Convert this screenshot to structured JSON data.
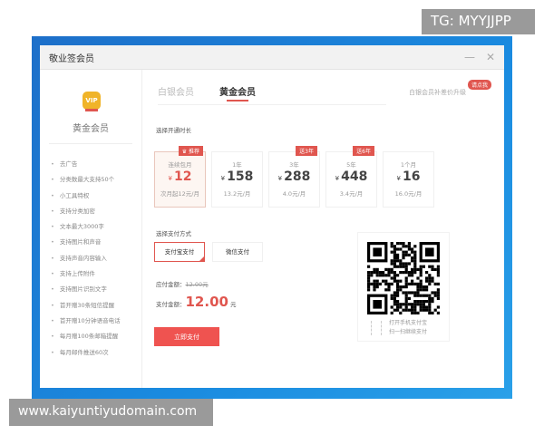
{
  "watermarks": {
    "top": "TG: MYYJJPP",
    "bottom": "www.kaiyuntiyudomain.com"
  },
  "window": {
    "title": "敬业签会员",
    "minimize": "—",
    "close": "✕"
  },
  "sidebar": {
    "badge": "VIP",
    "title": "黄金会员",
    "features": [
      "去广告",
      "分类数最大支持50个",
      "小工具特权",
      "支持分类加密",
      "文本最大3000字",
      "支持图片和声音",
      "支持声音内容输入",
      "支持上传附件",
      "支持图片识别文字",
      "首开赠30条短信提醒",
      "首开赠10分钟语音电话",
      "每月赠100条邮箱提醒",
      "每月邮件推送60次"
    ]
  },
  "tabs": [
    {
      "label": "白银会员",
      "active": false
    },
    {
      "label": "黄金会员",
      "active": true
    }
  ],
  "upgrade": {
    "label": "白银会员补差价升级",
    "badge": "请点我"
  },
  "duration_label": "选择开通时长",
  "currency": "¥",
  "plans": [
    {
      "name": "连续包月",
      "price": "12",
      "monthly": "次月起12元/月",
      "tag": "♛ 推荐",
      "selected": true
    },
    {
      "name": "1年",
      "price": "158",
      "monthly": "13.2元/月",
      "tag": "",
      "selected": false
    },
    {
      "name": "3年",
      "price": "288",
      "monthly": "4.0元/月",
      "tag": "送3年",
      "selected": false
    },
    {
      "name": "5年",
      "price": "448",
      "monthly": "3.4元/月",
      "tag": "送6年",
      "selected": false
    },
    {
      "name": "1个月",
      "price": "16",
      "monthly": "16.0元/月",
      "tag": "",
      "selected": false
    }
  ],
  "payment_label": "选择支付方式",
  "payment_methods": [
    {
      "label": "支付宝支付",
      "selected": true
    },
    {
      "label": "微信支付",
      "selected": false
    }
  ],
  "amount_due": {
    "label": "应付金额：",
    "value": "12.00元"
  },
  "amount_pay": {
    "label": "支付金额：",
    "value": "12.00",
    "unit": "元"
  },
  "pay_button": "立即支付",
  "qr": {
    "line1": "打开手机支付宝",
    "line2": "扫一扫继续支付"
  },
  "colors": {
    "accent": "#e0564f",
    "desktop": "#1a7fd6"
  }
}
